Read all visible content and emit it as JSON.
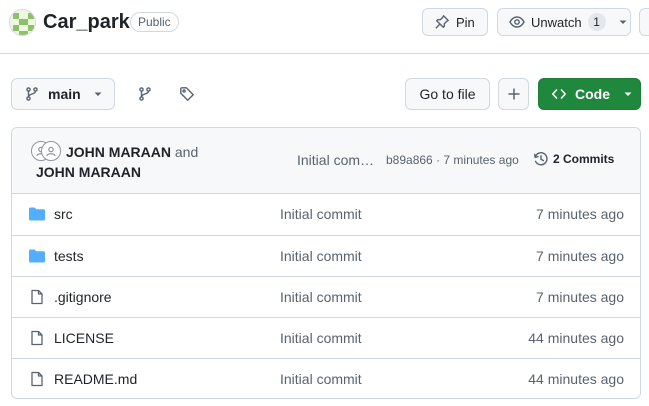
{
  "repo": {
    "name": "Car_park",
    "visibility": "Public"
  },
  "actions": {
    "pin_label": "Pin",
    "watch_label": "Unwatch",
    "watch_count": "1"
  },
  "toolbar": {
    "branch": "main",
    "go_to_file": "Go to file",
    "code_label": "Code"
  },
  "commit": {
    "author1": "JOHN MARAAN",
    "and_text": "and",
    "author2": "JOHN MARAAN",
    "message": "Initial commit",
    "hash": "b89a866",
    "separator": "·",
    "time": "7 minutes ago",
    "commits_count": "2 Commits"
  },
  "files": [
    {
      "type": "folder",
      "name": "src",
      "commit": "Initial commit",
      "time": "7 minutes ago"
    },
    {
      "type": "folder",
      "name": "tests",
      "commit": "Initial commit",
      "time": "7 minutes ago"
    },
    {
      "type": "file",
      "name": ".gitignore",
      "commit": "Initial commit",
      "time": "7 minutes ago"
    },
    {
      "type": "file",
      "name": "LICENSE",
      "commit": "Initial commit",
      "time": "44 minutes ago"
    },
    {
      "type": "file",
      "name": "README.md",
      "commit": "Initial commit",
      "time": "44 minutes ago"
    }
  ],
  "colors": {
    "accent_green": "#1f883d",
    "folder_blue": "#54aeff",
    "border": "#d1d9e0",
    "muted_text": "#59636e"
  }
}
